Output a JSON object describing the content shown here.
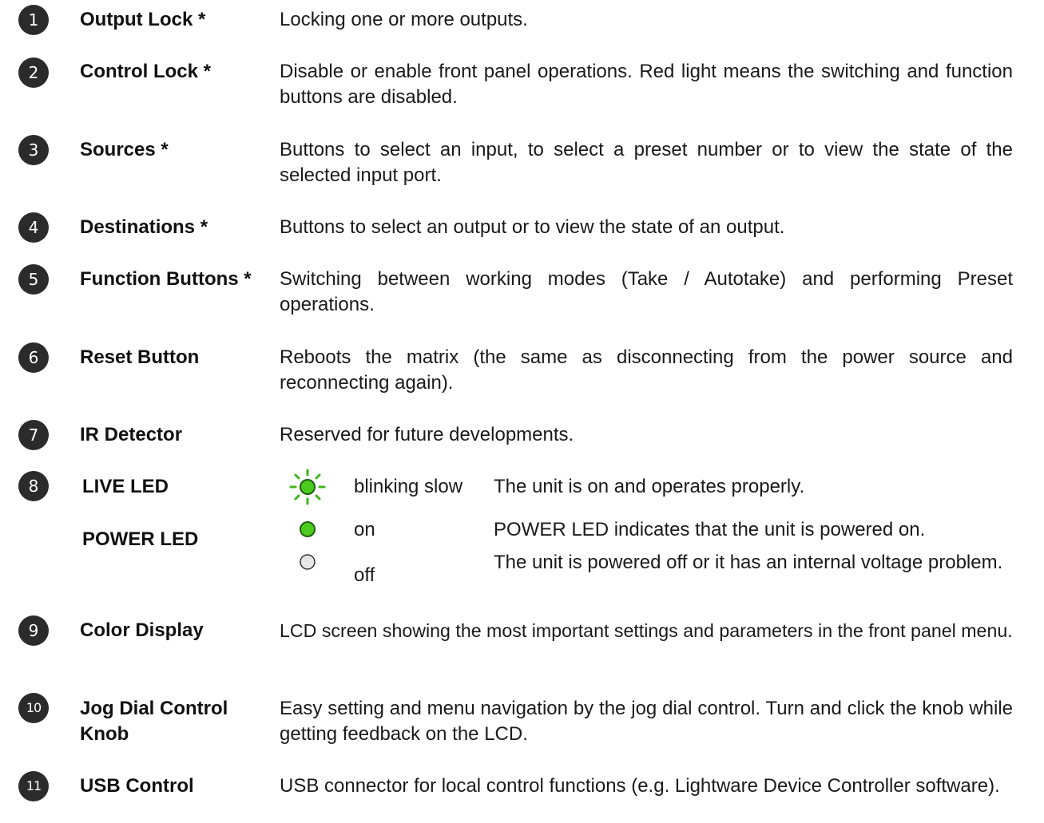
{
  "items": [
    {
      "num": "1",
      "term": "Output Lock *",
      "desc": "Locking one or more outputs."
    },
    {
      "num": "2",
      "term": "Control Lock *",
      "desc": "Disable or enable front panel operations. Red light means the switching and function buttons are disabled."
    },
    {
      "num": "3",
      "term": "Sources *",
      "desc": "Buttons to select an input, to select a preset number or to view the state of the selected input port."
    },
    {
      "num": "4",
      "term": "Destinations *",
      "desc": "Buttons to select an output or to view the state of an output."
    },
    {
      "num": "5",
      "term": "Function Buttons *",
      "desc": "Switching between working modes (Take / Autotake) and performing Preset operations."
    },
    {
      "num": "6",
      "term": "Reset Button",
      "desc": "Reboots the matrix (the same as disconnecting from the power source and reconnecting again)."
    },
    {
      "num": "7",
      "term": "IR Detector",
      "desc": "Reserved for future developments."
    },
    {
      "num": "8",
      "term": "LIVE LED",
      "term2": "POWER LED"
    },
    {
      "num": "9",
      "term": "Color Display",
      "desc": "LCD screen showing the most important settings and parameters in the front panel menu."
    },
    {
      "num": "10",
      "term": "Jog Dial Control Knob",
      "desc": "Easy setting and menu navigation by the jog dial control. Turn and click the knob while getting feedback on the LCD."
    },
    {
      "num": "11",
      "term": "USB Control",
      "desc": "USB connector for local control functions (e.g. Lightware Device Controller software)."
    }
  ],
  "led_states": [
    {
      "icon": "blinking-green-led-icon",
      "state": "blinking slow",
      "text": "The unit is on and operates properly."
    },
    {
      "icon": "green-led-icon",
      "state": "on",
      "text": "POWER LED indicates that the unit is powered on."
    },
    {
      "icon": "off-led-icon",
      "state": "off",
      "text": "The unit is powered off or it has an internal voltage problem."
    }
  ],
  "colors": {
    "badge": "#2b2b2b",
    "led_green": "#4ccb1f",
    "led_off": "#e6e6e6"
  }
}
